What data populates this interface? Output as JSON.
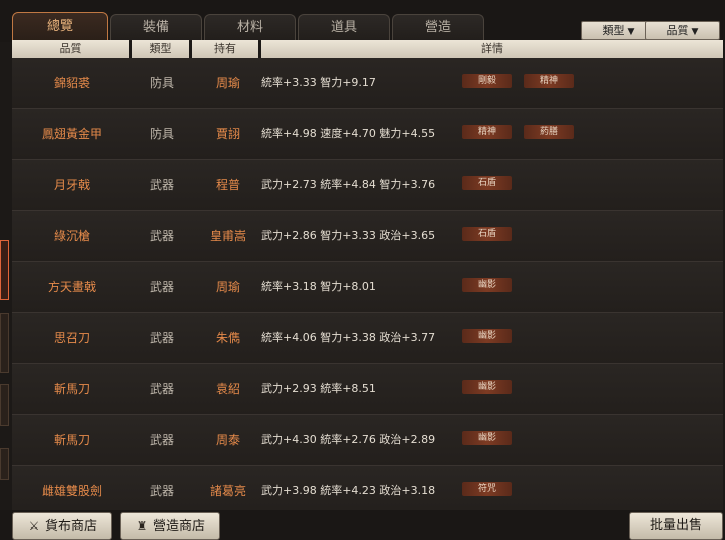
{
  "tabs": [
    {
      "label": "總覽",
      "active": true
    },
    {
      "label": "裝備"
    },
    {
      "label": "材料"
    },
    {
      "label": "道具"
    },
    {
      "label": "營造"
    }
  ],
  "filters": {
    "type": "類型",
    "quality": "品質"
  },
  "columns": {
    "quality": "品質",
    "type": "類型",
    "owner": "持有",
    "detail": "詳情"
  },
  "rows": [
    {
      "name": "錦貂裘",
      "type": "防具",
      "owner": "周瑜",
      "detail": "統率+3.33 智力+9.17",
      "tags": [
        "剛毅",
        "精神"
      ]
    },
    {
      "name": "鳳翅黃金甲",
      "type": "防具",
      "owner": "賈詡",
      "detail": "統率+4.98 速度+4.70 魅力+4.55",
      "tags": [
        "精神",
        "葯膳"
      ]
    },
    {
      "name": "月牙戟",
      "type": "武器",
      "owner": "程普",
      "detail": "武力+2.73 統率+4.84 智力+3.76",
      "tags": [
        "石盾"
      ]
    },
    {
      "name": "綠沉槍",
      "type": "武器",
      "owner": "皇甫嵩",
      "detail": "武力+2.86 智力+3.33 政治+3.65",
      "tags": [
        "石盾"
      ]
    },
    {
      "name": "方天畫戟",
      "type": "武器",
      "owner": "周瑜",
      "detail": "統率+3.18 智力+8.01",
      "tags": [
        "幽影"
      ]
    },
    {
      "name": "思召刀",
      "type": "武器",
      "owner": "朱儁",
      "detail": "統率+4.06 智力+3.38 政治+3.77",
      "tags": [
        "幽影"
      ]
    },
    {
      "name": "斬馬刀",
      "type": "武器",
      "owner": "袁紹",
      "detail": "武力+2.93 統率+8.51",
      "tags": [
        "幽影"
      ]
    },
    {
      "name": "斬馬刀",
      "type": "武器",
      "owner": "周泰",
      "detail": "武力+4.30 統率+2.76 政治+2.89",
      "tags": [
        "幽影"
      ]
    },
    {
      "name": "雌雄雙股劍",
      "type": "武器",
      "owner": "諸葛亮",
      "detail": "武力+3.98 統率+4.23 政治+3.18",
      "tags": [
        "符咒"
      ]
    }
  ],
  "buttons": {
    "shop": "貨布商店",
    "build_shop": "營造商店",
    "batch_sell": "批量出售"
  },
  "icons": {
    "shop": "sword-icon",
    "build_shop": "tower-icon"
  },
  "colors": {
    "accent": "#e58a4a",
    "tag_bg": "#7d3b23",
    "active_tab": "#c07843"
  }
}
